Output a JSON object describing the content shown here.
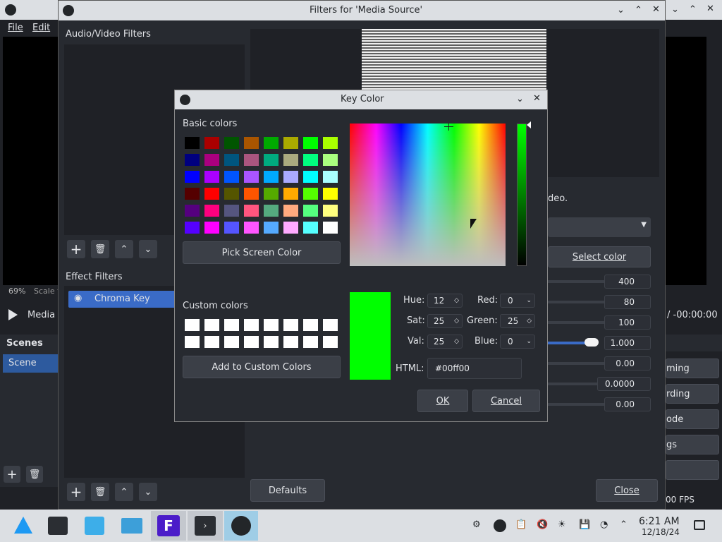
{
  "main_window": {
    "menu": [
      "File",
      "Edit"
    ],
    "zoom_text": "69%",
    "scale_text": "Scale t",
    "media_label": "Media",
    "scenes_header": "Scenes",
    "scene_item": "Scene",
    "time_text": "/ -00:00:00",
    "fps_text": "00 FPS",
    "right_buttons": [
      "ming",
      "rding",
      "ode",
      "gs"
    ]
  },
  "filters_window": {
    "title": "Filters for 'Media Source'",
    "audio_video_label": "Audio/Video Filters",
    "effect_filters_label": "Effect Filters",
    "effect_item": "Chroma Key",
    "defaults_label": "Defaults",
    "close_label": "Close",
    "partial_text": "deo.",
    "select_color_label": "Select color",
    "values": [
      "400",
      "80",
      "100",
      "1.000",
      "0.00",
      "0.0000",
      "0.00"
    ]
  },
  "key_color_dialog": {
    "title": "Key Color",
    "basic_colors_label": "Basic colors",
    "pick_screen_label": "Pick Screen Color",
    "custom_colors_label": "Custom colors",
    "add_custom_label": "Add to Custom Colors",
    "hue_label": "Hue:",
    "sat_label": "Sat:",
    "val_label": "Val:",
    "red_label": "Red:",
    "green_label": "Green:",
    "blue_label": "Blue:",
    "html_label": "HTML:",
    "hue_value": "12",
    "sat_value": "25",
    "val_value": "25",
    "red_value": "0",
    "green_value": "25",
    "blue_value": "0",
    "html_value": "#00ff00",
    "ok_label": "OK",
    "cancel_label": "Cancel",
    "current_color": "#00ff00",
    "basic_colors": [
      "#000000",
      "#aa0000",
      "#005500",
      "#aa5500",
      "#00aa00",
      "#aaaa00",
      "#00ff00",
      "#aaff00",
      "#00007f",
      "#aa007f",
      "#00557f",
      "#aa557f",
      "#00aa7f",
      "#aaaa7f",
      "#00ff7f",
      "#aaff7f",
      "#0000ff",
      "#aa00ff",
      "#0055ff",
      "#aa55ff",
      "#00aaff",
      "#aaaaff",
      "#00ffff",
      "#aaffff",
      "#550000",
      "#ff0000",
      "#555500",
      "#ff5500",
      "#55aa00",
      "#ffaa00",
      "#55ff00",
      "#ffff00",
      "#55007f",
      "#ff007f",
      "#55557f",
      "#ff557f",
      "#55aa7f",
      "#ffaa7f",
      "#55ff7f",
      "#ffff7f",
      "#5500ff",
      "#ff00ff",
      "#5555ff",
      "#ff55ff",
      "#55aaff",
      "#ffaaff",
      "#55ffff",
      "#ffffff"
    ]
  },
  "taskbar": {
    "clock_time": "6:21 AM",
    "clock_date": "12/18/24"
  }
}
